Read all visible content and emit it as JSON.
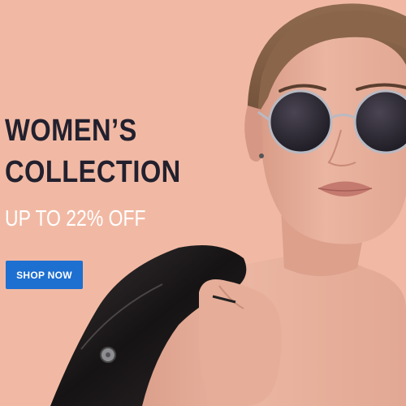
{
  "banner": {
    "headline_line1": "WOMEN’S",
    "headline_line2": "COLLECTION",
    "offer": "UP TO 22% OFF",
    "cta_label": "SHOP NOW"
  },
  "colors": {
    "background": "#f1b9a4",
    "headline": "#22202e",
    "offer_text": "#ffffff",
    "cta_background": "#1d6fd0",
    "cta_text": "#ffffff"
  }
}
